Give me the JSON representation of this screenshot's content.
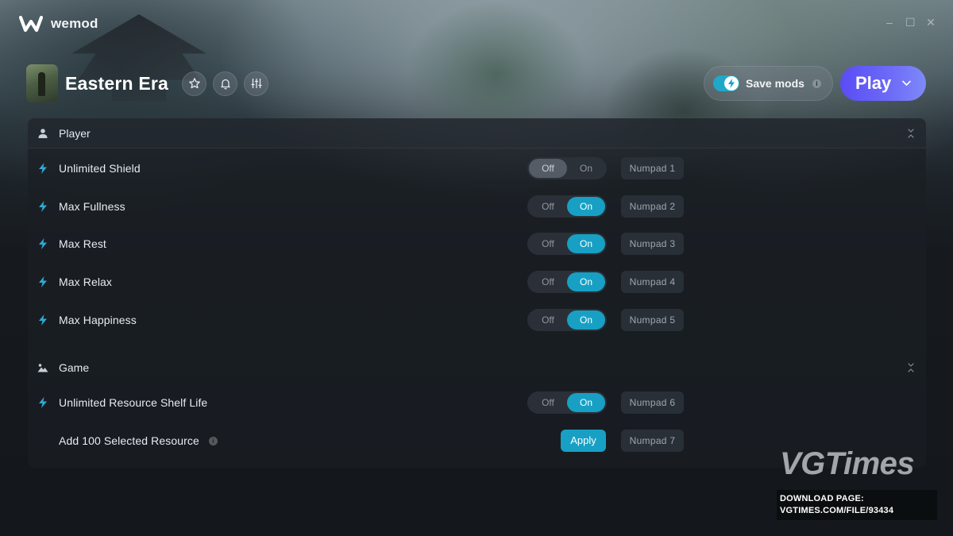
{
  "app": {
    "name": "wemod"
  },
  "window_controls": {
    "minimize": "–",
    "maximize": "☐",
    "close": "✕"
  },
  "game": {
    "title": "Eastern Era"
  },
  "header": {
    "save_mods_label": "Save mods",
    "save_mods_enabled": true,
    "info_glyph": "i",
    "play_label": "Play"
  },
  "toggle_labels": {
    "off": "Off",
    "on": "On"
  },
  "sections": [
    {
      "title": "Player",
      "mods": [
        {
          "label": "Unlimited Shield",
          "state": "Off",
          "hotkey": "Numpad 1"
        },
        {
          "label": "Max Fullness",
          "state": "On",
          "hotkey": "Numpad 2"
        },
        {
          "label": "Max Rest",
          "state": "On",
          "hotkey": "Numpad 3"
        },
        {
          "label": "Max Relax",
          "state": "On",
          "hotkey": "Numpad 4"
        },
        {
          "label": "Max Happiness",
          "state": "On",
          "hotkey": "Numpad 5"
        }
      ]
    },
    {
      "title": "Game",
      "mods": [
        {
          "label": "Unlimited Resource Shelf Life",
          "state": "On",
          "hotkey": "Numpad 6"
        },
        {
          "label": "Add 100 Selected Resource",
          "action_label": "Apply",
          "hotkey": "Numpad 7"
        }
      ]
    }
  ],
  "watermark": {
    "logo": "VGTimes",
    "line1": "DOWNLOAD PAGE:",
    "line2": "VGTIMES.COM/FILE/93434"
  },
  "colors": {
    "accent": "#17a0c4",
    "play_gradient_start": "#5a4cf5",
    "play_gradient_end": "#7f8af8"
  }
}
